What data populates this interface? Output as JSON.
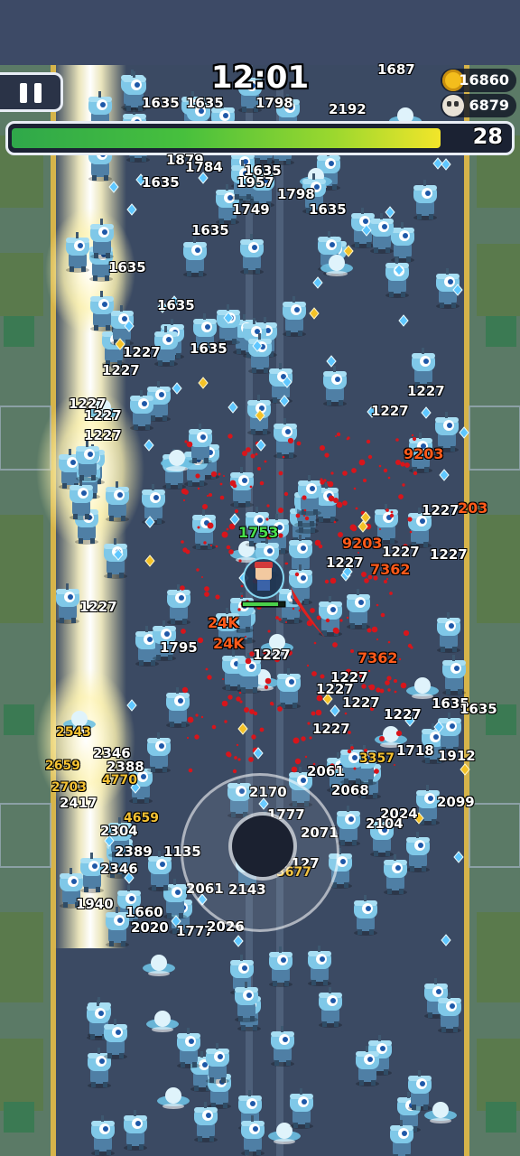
{
  "hud": {
    "timer": "12:01",
    "gold": "16860",
    "kills": "6879",
    "level": "28",
    "xp_progress": 0.92
  },
  "icons": {
    "pause": "pause-icon",
    "gold": "coin-icon",
    "kills": "skull-icon",
    "joystick": "joystick-icon"
  },
  "colors": {
    "road": "#3b4a63",
    "enemy": "#67b3d6",
    "lightning": "#fff4b0",
    "blood": "#d8151b",
    "gem": "#5fc7ff"
  },
  "player": {
    "damage_label": "1753",
    "health_progress": 0.85
  },
  "damage_numbers": [
    {
      "text": "1687",
      "cls": ""
    },
    {
      "text": "1635",
      "cls": ""
    },
    {
      "text": "1635",
      "cls": ""
    },
    {
      "text": "1798",
      "cls": ""
    },
    {
      "text": "2192",
      "cls": ""
    },
    {
      "text": "1879",
      "cls": ""
    },
    {
      "text": "1784",
      "cls": ""
    },
    {
      "text": "1635",
      "cls": ""
    },
    {
      "text": "1957",
      "cls": ""
    },
    {
      "text": "1635",
      "cls": ""
    },
    {
      "text": "1798",
      "cls": ""
    },
    {
      "text": "1749",
      "cls": ""
    },
    {
      "text": "1635",
      "cls": ""
    },
    {
      "text": "1635",
      "cls": ""
    },
    {
      "text": "1635",
      "cls": ""
    },
    {
      "text": "1635",
      "cls": ""
    },
    {
      "text": "1635",
      "cls": ""
    },
    {
      "text": "1227",
      "cls": ""
    },
    {
      "text": "1227",
      "cls": ""
    },
    {
      "text": "1227",
      "cls": ""
    },
    {
      "text": "1227",
      "cls": ""
    },
    {
      "text": "1227",
      "cls": ""
    },
    {
      "text": "1227",
      "cls": ""
    },
    {
      "text": "1227",
      "cls": ""
    },
    {
      "text": "9203",
      "cls": "crit"
    },
    {
      "text": "1227",
      "cls": ""
    },
    {
      "text": "203",
      "cls": "crit"
    },
    {
      "text": "9203",
      "cls": "crit"
    },
    {
      "text": "1227",
      "cls": ""
    },
    {
      "text": "1227",
      "cls": ""
    },
    {
      "text": "7362",
      "cls": "crit"
    },
    {
      "text": "1753",
      "cls": "heal"
    },
    {
      "text": "1227",
      "cls": ""
    },
    {
      "text": "1227",
      "cls": ""
    },
    {
      "text": "24K",
      "cls": "crit"
    },
    {
      "text": "24K",
      "cls": "crit"
    },
    {
      "text": "1795",
      "cls": ""
    },
    {
      "text": "1227",
      "cls": ""
    },
    {
      "text": "1227",
      "cls": ""
    },
    {
      "text": "1227",
      "cls": ""
    },
    {
      "text": "1227",
      "cls": ""
    },
    {
      "text": "7362",
      "cls": "crit"
    },
    {
      "text": "1227",
      "cls": ""
    },
    {
      "text": "1227",
      "cls": ""
    },
    {
      "text": "1635",
      "cls": ""
    },
    {
      "text": "1635",
      "cls": ""
    },
    {
      "text": "1718",
      "cls": ""
    },
    {
      "text": "1912",
      "cls": ""
    },
    {
      "text": "2061",
      "cls": ""
    },
    {
      "text": "2068",
      "cls": ""
    },
    {
      "text": "3357",
      "cls": "gold"
    },
    {
      "text": "2170",
      "cls": ""
    },
    {
      "text": "2099",
      "cls": ""
    },
    {
      "text": "1777",
      "cls": ""
    },
    {
      "text": "2024",
      "cls": ""
    },
    {
      "text": "2071",
      "cls": ""
    },
    {
      "text": "2104",
      "cls": ""
    },
    {
      "text": "2127",
      "cls": ""
    },
    {
      "text": "3677",
      "cls": "gold"
    },
    {
      "text": "2061",
      "cls": ""
    },
    {
      "text": "2143",
      "cls": ""
    },
    {
      "text": "2543",
      "cls": "gold"
    },
    {
      "text": "2346",
      "cls": ""
    },
    {
      "text": "2388",
      "cls": ""
    },
    {
      "text": "2659",
      "cls": "gold"
    },
    {
      "text": "4770",
      "cls": "gold"
    },
    {
      "text": "2703",
      "cls": "gold"
    },
    {
      "text": "2417",
      "cls": ""
    },
    {
      "text": "2304",
      "cls": ""
    },
    {
      "text": "4659",
      "cls": "gold"
    },
    {
      "text": "2389",
      "cls": ""
    },
    {
      "text": "2346",
      "cls": ""
    },
    {
      "text": "1135",
      "cls": ""
    },
    {
      "text": "1940",
      "cls": ""
    },
    {
      "text": "1660",
      "cls": ""
    },
    {
      "text": "2020",
      "cls": ""
    },
    {
      "text": "1777",
      "cls": ""
    },
    {
      "text": "2026",
      "cls": ""
    }
  ]
}
